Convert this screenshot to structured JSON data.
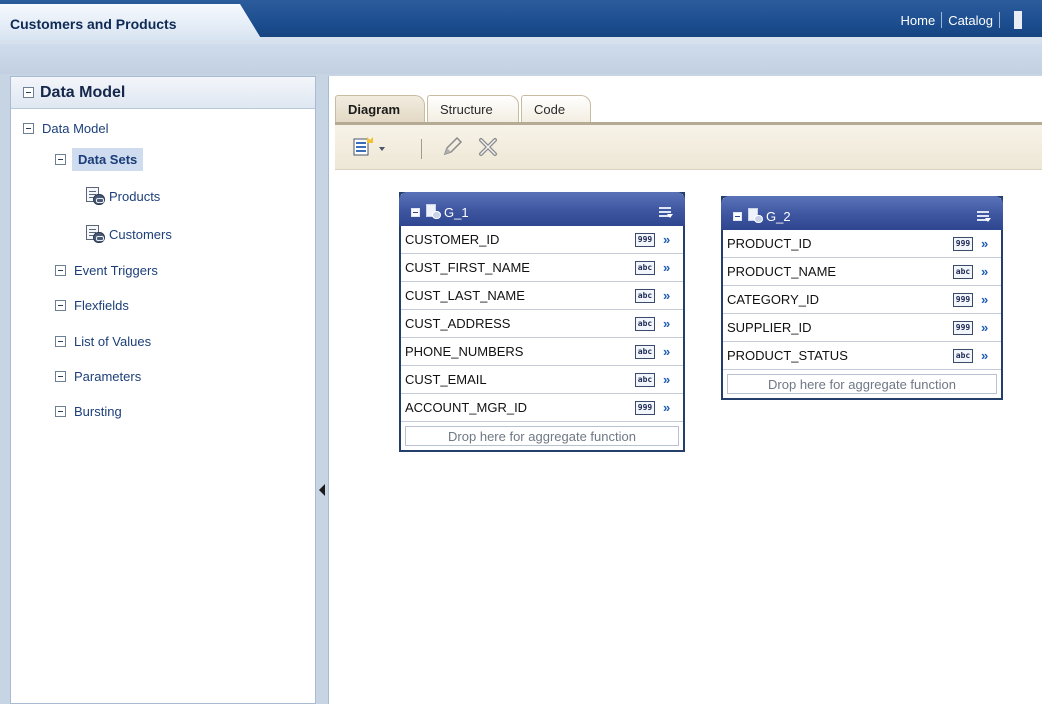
{
  "header": {
    "app_title": "Customers and Products",
    "links": {
      "home": "Home",
      "catalog": "Catalog"
    }
  },
  "sidebar": {
    "title": "Data Model",
    "tree": {
      "root": "Data Model",
      "data_sets": "Data Sets",
      "products": "Products",
      "customers": "Customers",
      "event_triggers": "Event Triggers",
      "flexfields": "Flexfields",
      "list_of_values": "List of Values",
      "parameters": "Parameters",
      "bursting": "Bursting"
    }
  },
  "main": {
    "tabs": [
      "Diagram",
      "Structure",
      "Code"
    ],
    "active_tab": "Diagram",
    "toolbar_icons": [
      "new-dataset-icon",
      "edit-pencil-icon",
      "delete-x-icon"
    ]
  },
  "groups": [
    {
      "name": "G_1",
      "fields": [
        {
          "name": "CUSTOMER_ID",
          "type": "999"
        },
        {
          "name": "CUST_FIRST_NAME",
          "type": "abc"
        },
        {
          "name": "CUST_LAST_NAME",
          "type": "abc"
        },
        {
          "name": "CUST_ADDRESS",
          "type": "abc"
        },
        {
          "name": "PHONE_NUMBERS",
          "type": "abc"
        },
        {
          "name": "CUST_EMAIL",
          "type": "abc"
        },
        {
          "name": "ACCOUNT_MGR_ID",
          "type": "999"
        }
      ],
      "drop_text": "Drop here for aggregate function"
    },
    {
      "name": "G_2",
      "fields": [
        {
          "name": "PRODUCT_ID",
          "type": "999"
        },
        {
          "name": "PRODUCT_NAME",
          "type": "abc"
        },
        {
          "name": "CATEGORY_ID",
          "type": "999"
        },
        {
          "name": "SUPPLIER_ID",
          "type": "999"
        },
        {
          "name": "PRODUCT_STATUS",
          "type": "abc"
        }
      ],
      "drop_text": "Drop here for aggregate function"
    }
  ],
  "colors": {
    "header_blue": "#1a4b8c",
    "group_header": "#3e56a0",
    "tab_tan": "#e2d8c3"
  }
}
